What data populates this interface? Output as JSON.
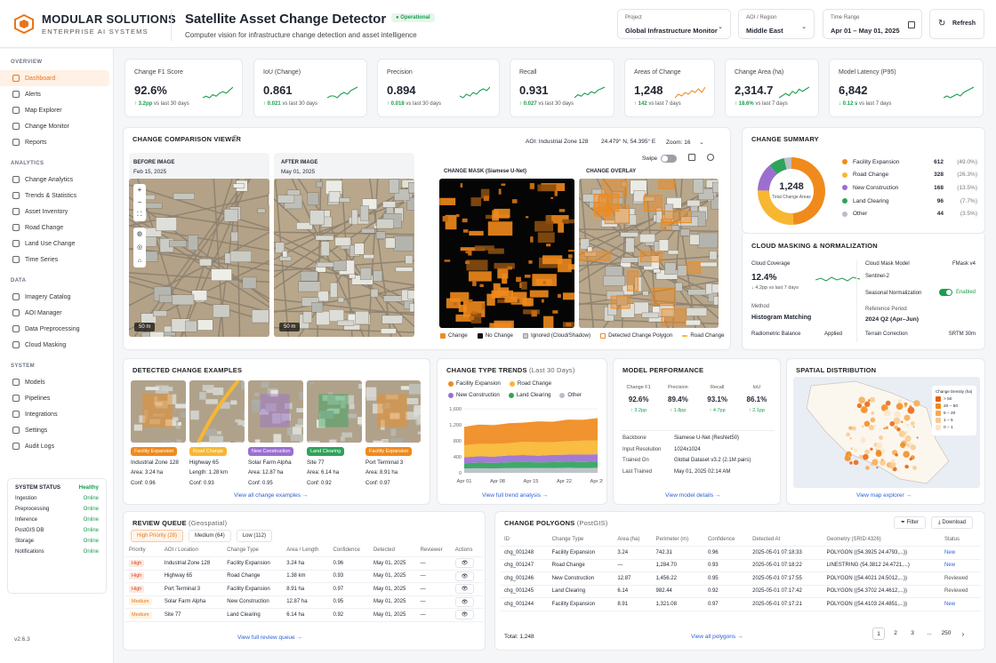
{
  "brand": {
    "name": "MODULAR SOLUTIONS",
    "sub": "ENTERPRISE AI SYSTEMS"
  },
  "header": {
    "title": "Satellite Asset Change Detector",
    "badge": "Operational",
    "subtitle": "Computer vision for infrastructure change detection and asset intelligence",
    "project_label": "Project",
    "project_value": "Global Infrastructure Monitor",
    "aoi_label": "AOI / Region",
    "aoi_value": "Middle East",
    "time_label": "Time Range",
    "time_value": "Apr 01 – May 01, 2025",
    "refresh": "Refresh"
  },
  "sidebar": {
    "overview": "OVERVIEW",
    "overview_items": [
      "Dashboard",
      "Alerts",
      "Map Explorer",
      "Change Monitor",
      "Reports"
    ],
    "analytics": "ANALYTICS",
    "analytics_items": [
      "Change Analytics",
      "Trends & Statistics",
      "Asset Inventory",
      "Road Change",
      "Land Use Change",
      "Time Series"
    ],
    "data": "DATA",
    "data_items": [
      "Imagery Catalog",
      "AOI Manager",
      "Data Preprocessing",
      "Cloud Masking"
    ],
    "system": "SYSTEM",
    "system_items": [
      "Models",
      "Pipelines",
      "Integrations",
      "Settings",
      "Audit Logs"
    ],
    "status_title": "SYSTEM STATUS",
    "status_overall": "Healthy",
    "status": [
      [
        "Ingestion",
        "Online"
      ],
      [
        "Preprocessing",
        "Online"
      ],
      [
        "Inference",
        "Online"
      ],
      [
        "PostGIS DB",
        "Online"
      ],
      [
        "Storage",
        "Online"
      ],
      [
        "Notifications",
        "Online"
      ]
    ],
    "version": "v2.6.3"
  },
  "kpis": [
    {
      "label": "Change F1 Score",
      "value": "92.6%",
      "arrow": "↑",
      "delta": "3.2pp",
      "note": "vs last 30 days",
      "trend": [
        5,
        6,
        5,
        7,
        6,
        8,
        9,
        8,
        10,
        12
      ]
    },
    {
      "label": "IoU (Change)",
      "value": "0.861",
      "arrow": "↑",
      "delta": "0.021",
      "note": "vs last 30 days",
      "trend": [
        5,
        6,
        6,
        5,
        7,
        8,
        7,
        9,
        10,
        11
      ]
    },
    {
      "label": "Precision",
      "value": "0.894",
      "arrow": "↑",
      "delta": "0.018",
      "note": "vs last 30 days",
      "trend": [
        6,
        5,
        7,
        6,
        8,
        7,
        9,
        10,
        9,
        11
      ]
    },
    {
      "label": "Recall",
      "value": "0.931",
      "arrow": "↑",
      "delta": "0.027",
      "note": "vs last 30 days",
      "trend": [
        5,
        7,
        6,
        8,
        7,
        9,
        8,
        10,
        11,
        12
      ]
    },
    {
      "label": "Areas of Change",
      "value": "1,248",
      "arrow": "↑",
      "delta": "142",
      "note": "vs last 7 days",
      "trend": [
        6,
        8,
        7,
        9,
        8,
        10,
        9,
        11,
        9,
        12
      ]
    },
    {
      "label": "Change Area (ha)",
      "value": "2,314.7",
      "arrow": "↑",
      "delta": "18.6%",
      "note": "vs last 7 days",
      "trend": [
        6,
        7,
        8,
        7,
        9,
        8,
        10,
        9,
        10,
        11
      ]
    },
    {
      "label": "Model Latency (P95)",
      "value": "6,842",
      "arrow": "↓",
      "delta": "0.12 s",
      "note": "vs last 7 days",
      "trend": [
        5,
        6,
        5,
        6,
        7,
        6,
        8,
        9,
        10,
        11
      ]
    }
  ],
  "viewer": {
    "title": "CHANGE COMPARISON VIEWER",
    "aoi": "AOI: Industrial Zone 128",
    "coords": "24.479° N, 54.395° E",
    "zoom": "Zoom: 16",
    "before": "BEFORE IMAGE",
    "before_date": "Feb 15, 2025",
    "after": "AFTER IMAGE",
    "after_date": "May 01, 2025",
    "mask": "CHANGE MASK (Siamese U-Net)",
    "overlay": "CHANGE OVERLAY",
    "swipe": "Swipe",
    "scale": "50 m",
    "legend": [
      "Change",
      "No Change",
      "Ignored (Cloud/Shadow)",
      "Detected Change Polygon",
      "Road Change"
    ]
  },
  "summary": {
    "title": "CHANGE SUMMARY",
    "total": "1,248",
    "total_label": "Total Change Areas",
    "items": [
      {
        "name": "Facility Expansion",
        "count": "612",
        "pct": "(49.0%)",
        "color": "#f08a1c",
        "value": 612
      },
      {
        "name": "Road Change",
        "count": "328",
        "pct": "(26.3%)",
        "color": "#f7b731",
        "value": 328
      },
      {
        "name": "New Construction",
        "count": "168",
        "pct": "(13.5%)",
        "color": "#9b6fd0",
        "value": 168
      },
      {
        "name": "Land Clearing",
        "count": "96",
        "pct": "(7.7%)",
        "color": "#2fa35a",
        "value": 96
      },
      {
        "name": "Other",
        "count": "44",
        "pct": "(3.5%)",
        "color": "#b9bec7",
        "value": 44
      }
    ]
  },
  "cloud": {
    "title": "CLOUD MASKING & NORMALIZATION",
    "cov_label": "Cloud Coverage",
    "cov_value": "12.4%",
    "cov_arrow": "↓",
    "cov_delta": "4.2pp",
    "cov_note": "vs last 7 days",
    "model_label": "Cloud Mask Model",
    "model_value": "FMask v4",
    "sensor": "Sentinel-2",
    "seasonal": "Seasonal Normalization",
    "enabled": "Enabled",
    "method_label": "Method",
    "method_value": "Histogram Matching",
    "ref_label": "Reference Period",
    "ref_value": "2024 Q2 (Apr–Jun)",
    "radio_label": "Radiometric Balance",
    "radio_value": "Applied",
    "terrain_label": "Terrain Correction",
    "terrain_value": "SRTM 30m"
  },
  "examples": {
    "title": "DETECTED CHANGE EXAMPLES",
    "link": "View all change examples →",
    "items": [
      {
        "tag": "Facility Expansion",
        "color": "#f08a1c",
        "name": "Industrial Zone 128",
        "line1": "Area: 3.24 ha",
        "line2": "Conf: 0.96"
      },
      {
        "tag": "Road Change",
        "color": "#f7b731",
        "name": "Highway 65",
        "line1": "Length: 1.28 km",
        "line2": "Conf: 0.93"
      },
      {
        "tag": "New Construction",
        "color": "#9b6fd0",
        "name": "Solar Farm Alpha",
        "line1": "Area: 12.87 ha",
        "line2": "Conf: 0.95"
      },
      {
        "tag": "Land Clearing",
        "color": "#2fa35a",
        "name": "Site 77",
        "line1": "Area: 6.14 ha",
        "line2": "Conf: 0.92"
      },
      {
        "tag": "Facility Expansion",
        "color": "#f08a1c",
        "name": "Port Terminal 3",
        "line1": "Area: 8.91 ha",
        "line2": "Conf: 0.97"
      }
    ]
  },
  "trends": {
    "title": "CHANGE TYPE TRENDS",
    "subtitle": "(Last 30 Days)",
    "link": "View full trend analysis →",
    "legend": [
      [
        "Facility Expansion",
        "#f08a1c"
      ],
      [
        "Road Change",
        "#f7b731"
      ],
      [
        "New Construction",
        "#9b6fd0"
      ],
      [
        "Land Clearing",
        "#2fa35a"
      ],
      [
        "Other",
        "#b9bec7"
      ]
    ]
  },
  "chart_data": {
    "type": "area",
    "x": [
      "Apr 01",
      "Apr 08",
      "Apr 15",
      "Apr 22",
      "Apr 29"
    ],
    "ylim": [
      0,
      1600
    ],
    "yticks": [
      "0",
      "400",
      "800",
      "1,200",
      "1,600"
    ],
    "series": [
      {
        "name": "Other",
        "color": "#b9bec7",
        "values": [
          110,
          115,
          112,
          118,
          120,
          122,
          118,
          125,
          120,
          125
        ]
      },
      {
        "name": "Land Clearing",
        "color": "#2fa35a",
        "values": [
          130,
          140,
          135,
          145,
          150,
          140,
          150,
          155,
          150,
          160
        ]
      },
      {
        "name": "New Construction",
        "color": "#9b6fd0",
        "values": [
          150,
          160,
          155,
          170,
          175,
          165,
          180,
          175,
          185,
          180
        ]
      },
      {
        "name": "Road Change",
        "color": "#f7b731",
        "values": [
          300,
          310,
          320,
          305,
          330,
          340,
          320,
          335,
          350,
          345
        ]
      },
      {
        "name": "Facility Expansion",
        "color": "#f08a1c",
        "values": [
          460,
          480,
          470,
          500,
          480,
          520,
          510,
          540,
          520,
          560
        ]
      }
    ]
  },
  "model": {
    "title": "MODEL PERFORMANCE",
    "metrics": [
      [
        "Change F1",
        "92.6%",
        "↑ 3.2pp"
      ],
      [
        "Precision",
        "89.4%",
        "↑ 1.8pp"
      ],
      [
        "Recall",
        "93.1%",
        "↑ 4.7pp"
      ],
      [
        "IoU",
        "86.1%",
        "↑ 2.1pp"
      ]
    ],
    "details": [
      [
        "Backbone",
        "Siamese U-Net (ResNet50)"
      ],
      [
        "Input Resolution",
        "1024x1024"
      ],
      [
        "Trained On",
        "Global Dataset v3.2 (2.1M pairs)"
      ],
      [
        "Last Trained",
        "May 01, 2025 02:14 AM"
      ]
    ],
    "link": "View model details →"
  },
  "spatial": {
    "title": "SPATIAL DISTRIBUTION",
    "legend_title": "Change Density (ha)",
    "bins": [
      [
        "> 50",
        "#e8610c"
      ],
      [
        "20 – 50",
        "#f08a1c"
      ],
      [
        "5 – 20",
        "#f7a94d"
      ],
      [
        "1 – 5",
        "#f9c98d"
      ],
      [
        "0 – 1",
        "#fce5c6"
      ]
    ],
    "link": "View map explorer →"
  },
  "queue": {
    "title": "REVIEW QUEUE",
    "subtitle": "(Geospatial)",
    "tabs": [
      "High Priority (28)",
      "Medium (64)",
      "Low (112)"
    ],
    "cols": [
      "Priority",
      "AOI / Location",
      "Change Type",
      "Area / Length",
      "Confidence",
      "Detected",
      "Reviewer",
      "Actions"
    ],
    "rows": [
      [
        "High",
        "Industrial Zone 128",
        "Facility Expansion",
        "3.24 ha",
        "0.96",
        "May 01, 2025",
        "—"
      ],
      [
        "High",
        "Highway 65",
        "Road Change",
        "1.38 km",
        "0.93",
        "May 01, 2025",
        "—"
      ],
      [
        "High",
        "Port Terminal 3",
        "Facility Expansion",
        "8.91 ha",
        "0.97",
        "May 01, 2025",
        "—"
      ],
      [
        "Medium",
        "Solar Farm Alpha",
        "New Construction",
        "12.87 ha",
        "0.95",
        "May 01, 2025",
        "—"
      ],
      [
        "Medium",
        "Site 77",
        "Land Clearing",
        "6.14 ha",
        "0.92",
        "May 01, 2025",
        "—"
      ]
    ],
    "link": "View full review queue →"
  },
  "polygons": {
    "title": "CHANGE POLYGONS",
    "subtitle": "(PostGIS)",
    "filter": "Filter",
    "download": "Download",
    "cols": [
      "ID",
      "Change Type",
      "Area (ha)",
      "Perimeter (m)",
      "Confidence",
      "Detected At",
      "Geometry (SRID:4326)",
      "Status"
    ],
    "rows": [
      [
        "chg_001248",
        "Facility Expansion",
        "3.24",
        "742.31",
        "0.96",
        "2025-05-01 07:18:33",
        "POLYGON ((54.3925 24.4793,...))",
        "New"
      ],
      [
        "chg_001247",
        "Road Change",
        "—",
        "1,284.70",
        "0.93",
        "2025-05-01 07:18:22",
        "LINESTRING (54.3812 24.4721,...)",
        "New"
      ],
      [
        "chg_001246",
        "New Construction",
        "12.87",
        "1,456.22",
        "0.95",
        "2025-05-01 07:17:55",
        "POLYGON ((54.4021 24.5012,...))",
        "Reviewed"
      ],
      [
        "chg_001245",
        "Land Clearing",
        "6.14",
        "982.44",
        "0.92",
        "2025-05-01 07:17:42",
        "POLYGON ((54.3702 24.4612,...))",
        "Reviewed"
      ],
      [
        "chg_001244",
        "Facility Expansion",
        "8.91",
        "1,321.08",
        "0.97",
        "2025-05-01 07:17:21",
        "POLYGON ((54.4103 24.4851,...))",
        "New"
      ]
    ],
    "total": "Total: 1,248",
    "link": "View all polygons →",
    "pages": [
      "1",
      "2",
      "3",
      "...",
      "250"
    ]
  }
}
